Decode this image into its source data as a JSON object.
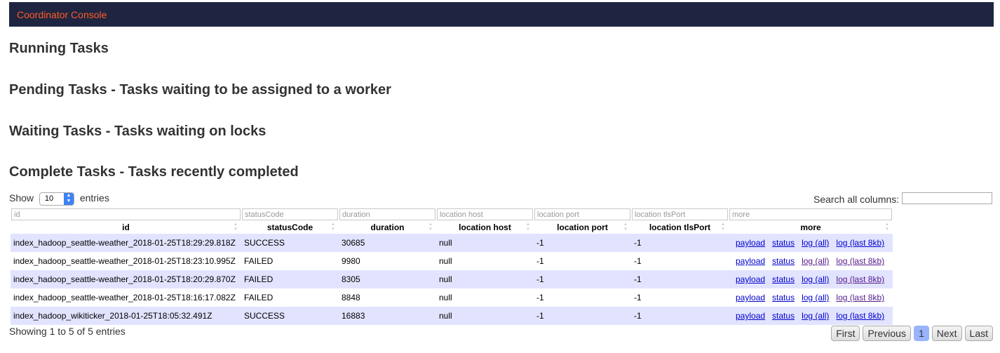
{
  "app": {
    "title": "Coordinator Console"
  },
  "sections": {
    "running": "Running Tasks",
    "pending": "Pending Tasks - Tasks waiting to be assigned to a worker",
    "waiting": "Waiting Tasks - Tasks waiting on locks",
    "complete": "Complete Tasks - Tasks recently completed"
  },
  "controls": {
    "show_label": "Show",
    "entries_value": "10",
    "entries_label": "entries",
    "search_label": "Search all columns:",
    "search_value": ""
  },
  "table": {
    "columns": [
      {
        "key": "id",
        "label": "id",
        "placeholder": "id"
      },
      {
        "key": "statusCode",
        "label": "statusCode",
        "placeholder": "statusCode"
      },
      {
        "key": "duration",
        "label": "duration",
        "placeholder": "duration"
      },
      {
        "key": "location_host",
        "label": "location host",
        "placeholder": "location host"
      },
      {
        "key": "location_port",
        "label": "location port",
        "placeholder": "location port"
      },
      {
        "key": "location_tlsPort",
        "label": "location tlsPort",
        "placeholder": "location tlsPort"
      },
      {
        "key": "more",
        "label": "more",
        "placeholder": "more"
      }
    ],
    "rows": [
      {
        "id": "index_hadoop_seattle-weather_2018-01-25T18:29:29.818Z",
        "statusCode": "SUCCESS",
        "duration": "30685",
        "location_host": "null",
        "location_port": "-1",
        "location_tlsPort": "-1"
      },
      {
        "id": "index_hadoop_seattle-weather_2018-01-25T18:23:10.995Z",
        "statusCode": "FAILED",
        "duration": "9980",
        "location_host": "null",
        "location_port": "-1",
        "location_tlsPort": "-1"
      },
      {
        "id": "index_hadoop_seattle-weather_2018-01-25T18:20:29.870Z",
        "statusCode": "FAILED",
        "duration": "8305",
        "location_host": "null",
        "location_port": "-1",
        "location_tlsPort": "-1"
      },
      {
        "id": "index_hadoop_seattle-weather_2018-01-25T18:16:17.082Z",
        "statusCode": "FAILED",
        "duration": "8848",
        "location_host": "null",
        "location_port": "-1",
        "location_tlsPort": "-1"
      },
      {
        "id": "index_hadoop_wikiticker_2018-01-25T18:05:32.491Z",
        "statusCode": "SUCCESS",
        "duration": "16883",
        "location_host": "null",
        "location_port": "-1",
        "location_tlsPort": "-1"
      }
    ],
    "links": {
      "payload": "payload",
      "status": "status",
      "log_all": "log (all)",
      "log_last": "log (last 8kb)"
    }
  },
  "footer": {
    "info": "Showing 1 to 5 of 5 entries",
    "first": "First",
    "previous": "Previous",
    "page": "1",
    "next": "Next",
    "last": "Last"
  },
  "colors": {
    "topbar": "#1f2541",
    "brand": "#ff5a24",
    "row_odd": "#e2e4ff",
    "active_page": "#99b3ff"
  }
}
